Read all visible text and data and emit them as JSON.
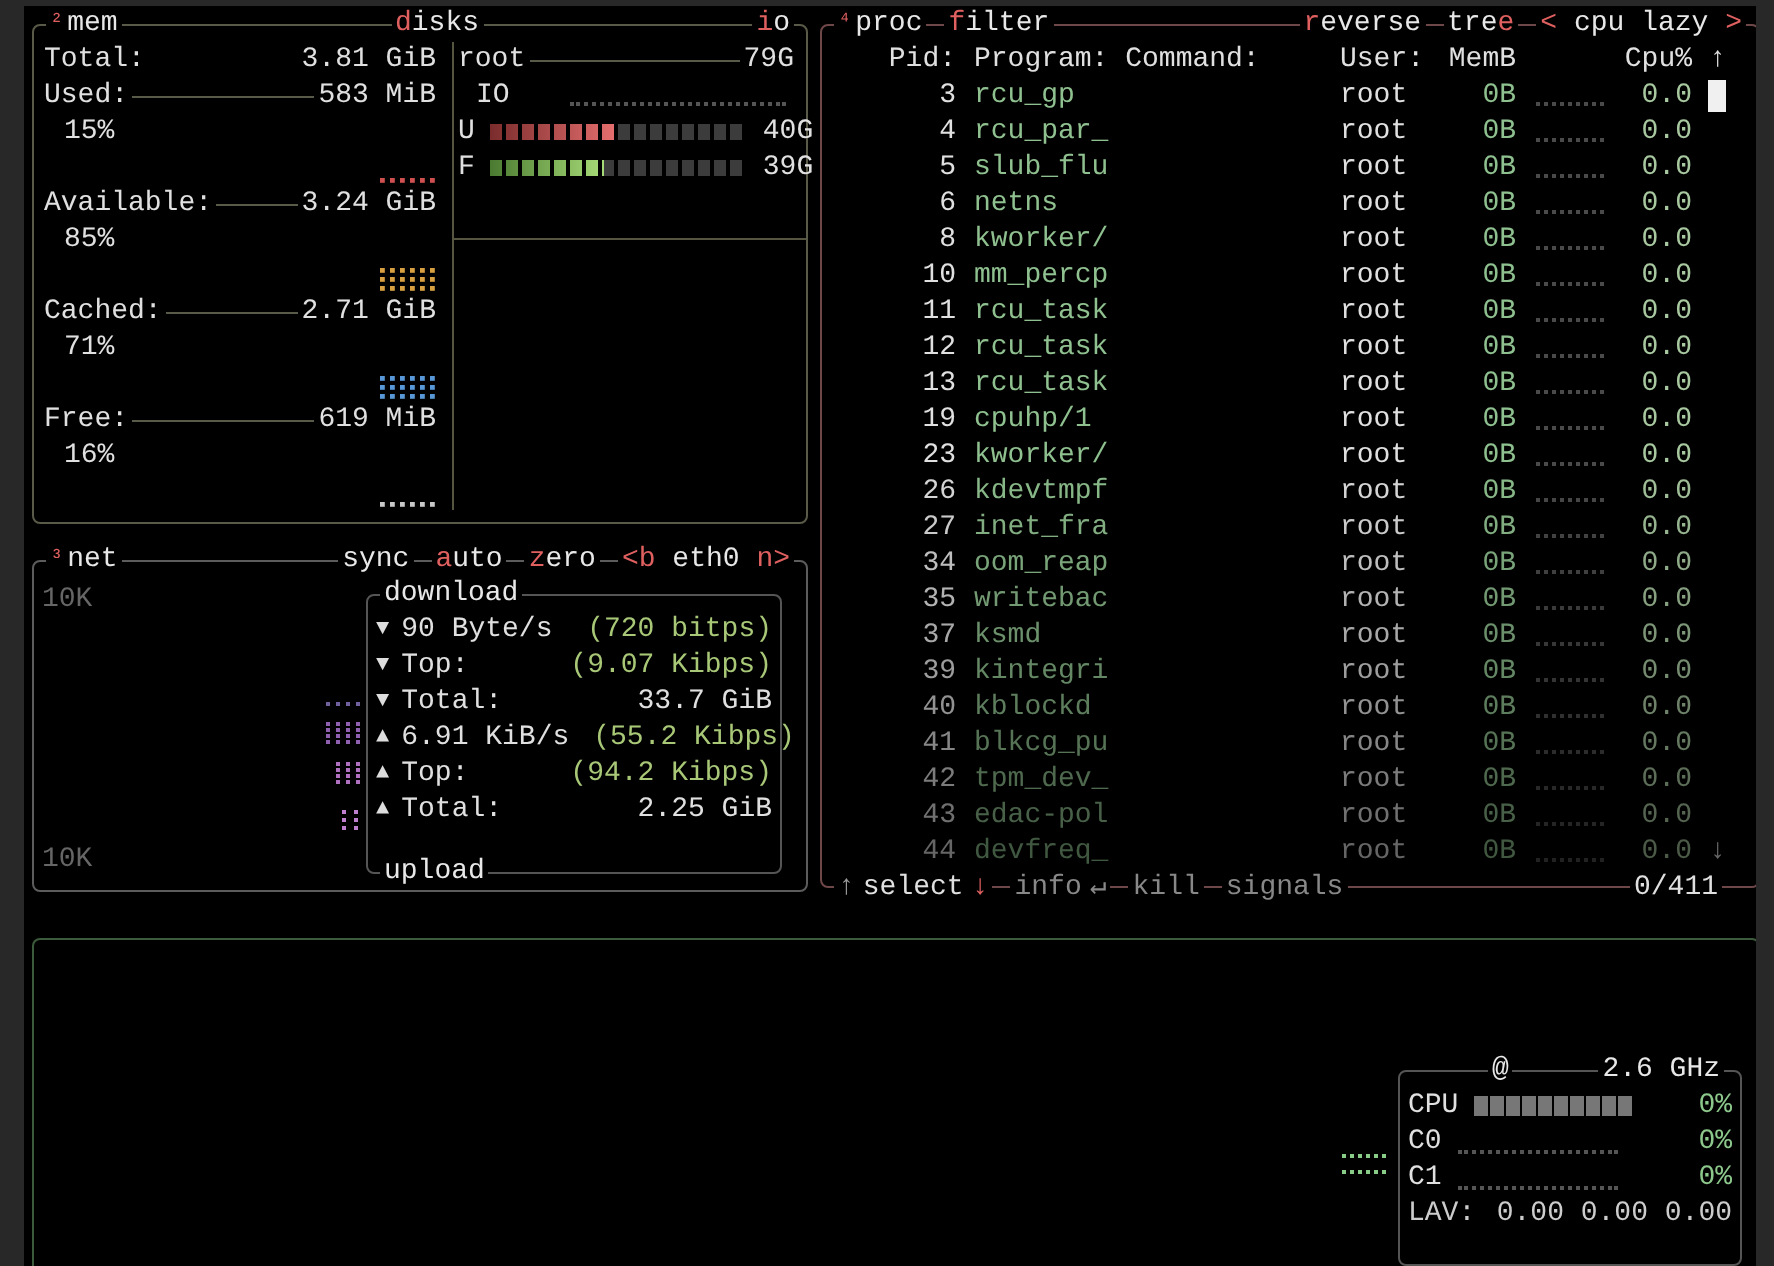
{
  "mem": {
    "number": "²",
    "title": "mem",
    "total": {
      "label": "Total:",
      "value": "3.81 GiB"
    },
    "items": [
      {
        "label": "Used:",
        "value": "583 MiB",
        "percent": "15%",
        "color": "#d05050"
      },
      {
        "label": "Available:",
        "value": "3.24 GiB",
        "percent": "85%",
        "color": "#d8a040"
      },
      {
        "label": "Cached:",
        "value": "2.71 GiB",
        "percent": "71%",
        "color": "#5898d8"
      },
      {
        "label": "Free:",
        "value": "619 MiB",
        "percent": "16%",
        "color": "#c8c8c8"
      }
    ]
  },
  "disks": {
    "title": {
      "key": "d",
      "post": "isks"
    },
    "io": {
      "key": "i",
      "post": "o"
    },
    "name": "root",
    "size": "79G",
    "io_label": "IO",
    "meters": [
      {
        "label": "U",
        "level": 0.5,
        "value": "40G",
        "kind": "used"
      },
      {
        "label": "F",
        "level": 0.44,
        "value": "39G",
        "kind": "free"
      }
    ]
  },
  "net": {
    "number": "³",
    "title": "net",
    "options": [
      {
        "post": "sync"
      },
      {
        "key": "a",
        "post": "uto"
      },
      {
        "key": "z",
        "post": "ero"
      }
    ],
    "interface": {
      "prev": "<b",
      "name": "eth0",
      "next": "n>"
    },
    "scale_top": "10K",
    "scale_bottom": "10K",
    "download_title": "download",
    "upload_title": "upload",
    "stats": [
      {
        "arrow": "▼",
        "label": "90 Byte/s",
        "kind": "bits",
        "value": "(720 bitps)"
      },
      {
        "arrow": "▼",
        "label": "Top:",
        "kind": "bits",
        "value": "(9.07 Kibps)"
      },
      {
        "arrow": "▼",
        "label": "Total:",
        "kind": "total",
        "value": "33.7 GiB"
      },
      {
        "arrow": "▲",
        "label": "6.91 KiB/s",
        "kind": "bits",
        "value": "(55.2 Kibps)"
      },
      {
        "arrow": "▲",
        "label": "Top:",
        "kind": "bits",
        "value": "(94.2 Kibps)"
      },
      {
        "arrow": "▲",
        "label": "Total:",
        "kind": "total",
        "value": "2.25 GiB"
      }
    ]
  },
  "proc": {
    "number": "⁴",
    "title": "proc",
    "filter": {
      "key": "f",
      "post": "ilter"
    },
    "reverse": {
      "key": "r",
      "post": "everse"
    },
    "tree": {
      "pre": "tre",
      "key": "e"
    },
    "sort": {
      "prev": "<",
      "name": "cpu lazy",
      "next": ">"
    },
    "columns": {
      "pid": "Pid:",
      "program": "Program:",
      "command": "Command:",
      "user": "User:",
      "mem": "MemB",
      "cpu": "Cpu%"
    },
    "sort_arrow": "↑",
    "end_arrow": "↓",
    "rows": [
      {
        "pid": "3",
        "program": "rcu_gp",
        "user": "root",
        "mem": "0B",
        "cpu": "0.0"
      },
      {
        "pid": "4",
        "program": "rcu_par_",
        "user": "root",
        "mem": "0B",
        "cpu": "0.0"
      },
      {
        "pid": "5",
        "program": "slub_flu",
        "user": "root",
        "mem": "0B",
        "cpu": "0.0"
      },
      {
        "pid": "6",
        "program": "netns",
        "user": "root",
        "mem": "0B",
        "cpu": "0.0"
      },
      {
        "pid": "8",
        "program": "kworker/",
        "user": "root",
        "mem": "0B",
        "cpu": "0.0"
      },
      {
        "pid": "10",
        "program": "mm_percp",
        "user": "root",
        "mem": "0B",
        "cpu": "0.0"
      },
      {
        "pid": "11",
        "program": "rcu_task",
        "user": "root",
        "mem": "0B",
        "cpu": "0.0"
      },
      {
        "pid": "12",
        "program": "rcu_task",
        "user": "root",
        "mem": "0B",
        "cpu": "0.0"
      },
      {
        "pid": "13",
        "program": "rcu_task",
        "user": "root",
        "mem": "0B",
        "cpu": "0.0"
      },
      {
        "pid": "19",
        "program": "cpuhp/1",
        "user": "root",
        "mem": "0B",
        "cpu": "0.0"
      },
      {
        "pid": "23",
        "program": "kworker/",
        "user": "root",
        "mem": "0B",
        "cpu": "0.0"
      },
      {
        "pid": "26",
        "program": "kdevtmpf",
        "user": "root",
        "mem": "0B",
        "cpu": "0.0"
      },
      {
        "pid": "27",
        "program": "inet_fra",
        "user": "root",
        "mem": "0B",
        "cpu": "0.0"
      },
      {
        "pid": "34",
        "program": "oom_reap",
        "user": "root",
        "mem": "0B",
        "cpu": "0.0"
      },
      {
        "pid": "35",
        "program": "writebac",
        "user": "root",
        "mem": "0B",
        "cpu": "0.0"
      },
      {
        "pid": "37",
        "program": "ksmd",
        "user": "root",
        "mem": "0B",
        "cpu": "0.0"
      },
      {
        "pid": "39",
        "program": "kintegri",
        "user": "root",
        "mem": "0B",
        "cpu": "0.0"
      },
      {
        "pid": "40",
        "program": "kblockd",
        "user": "root",
        "mem": "0B",
        "cpu": "0.0"
      },
      {
        "pid": "41",
        "program": "blkcg_pu",
        "user": "root",
        "mem": "0B",
        "cpu": "0.0"
      },
      {
        "pid": "42",
        "program": "tpm_dev_",
        "user": "root",
        "mem": "0B",
        "cpu": "0.0"
      },
      {
        "pid": "43",
        "program": "edac-pol",
        "user": "root",
        "mem": "0B",
        "cpu": "0.0"
      },
      {
        "pid": "44",
        "program": "devfreq_",
        "user": "root",
        "mem": "0B",
        "cpu": "0.0"
      }
    ],
    "footer": {
      "up": "↑",
      "select": "select",
      "down": "↓",
      "info": "info",
      "enter": "↵",
      "kill": "kill",
      "signals": "signals",
      "count": "0/411"
    }
  },
  "cpu": {
    "symbol": "@",
    "freq": "2.6 GHz",
    "meters": [
      {
        "label": "CPU",
        "level": 0,
        "value": "0%",
        "kind": "bar"
      },
      {
        "label": "C0",
        "level": 0,
        "value": "0%",
        "kind": "dots"
      },
      {
        "label": "C1",
        "level": 0,
        "value": "0%",
        "kind": "dots"
      }
    ],
    "load": {
      "label": "LAV:",
      "values": "0.00 0.00 0.00"
    }
  }
}
